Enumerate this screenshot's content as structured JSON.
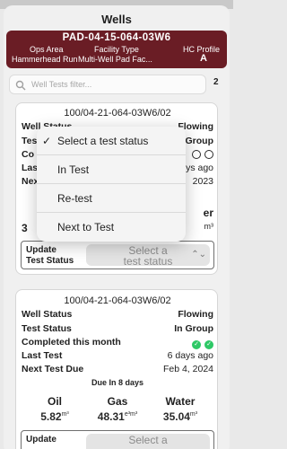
{
  "app_title": "Wells",
  "header": {
    "pad_name": "PAD-04-15-064-03W6",
    "labels": {
      "ops_area": "Ops Area",
      "facility_type": "Facility Type",
      "hc_profile": "HC Profile"
    },
    "values": {
      "ops_area": "Hammerhead Run",
      "facility_type": "Multi-Well Pad Fac...",
      "hc_profile": "A"
    }
  },
  "search": {
    "placeholder": "Well Tests filter...",
    "count": "2"
  },
  "card1": {
    "title": "100/04-21-064-03W6/02",
    "well_status_label": "Well Status",
    "well_status": "Flowing",
    "test_status_label": "Test",
    "test_status": "n Group",
    "completed_label": "Co",
    "last_test_label": "Last",
    "last_test": "ys ago",
    "next_test_label": "Next",
    "next_test": "2023",
    "water_label": "er",
    "oil_value_partial": "3",
    "gas_value_partial": "m³",
    "update_label_1": "Update",
    "update_label_2": "Test Status",
    "select_line1": "Select a",
    "select_line2": "test status"
  },
  "dropdown": {
    "options": [
      {
        "label": "Select a test status",
        "checked": "✓"
      },
      {
        "label": "In Test"
      },
      {
        "label": "Re-test"
      },
      {
        "label": "Next to Test"
      }
    ]
  },
  "card2": {
    "title": "100/04-21-064-03W6/02",
    "well_status_label": "Well Status",
    "well_status": "Flowing",
    "test_status_label": "Test Status",
    "test_status": "In Group",
    "completed_label": "Completed this month",
    "last_test_label": "Last Test",
    "last_test": "6 days ago",
    "next_test_label": "Next Test Due",
    "next_test": "Feb 4, 2024",
    "due_in": "Due In 8 days",
    "oil_label": "Oil",
    "gas_label": "Gas",
    "water_label": "Water",
    "oil_value": "5.82",
    "oil_unit": "m³",
    "gas_value": "48.31",
    "gas_unit": "e³m³",
    "water_value": "35.04",
    "water_unit": "m³",
    "update_label_1": "Update",
    "select_line1": "Select a"
  }
}
